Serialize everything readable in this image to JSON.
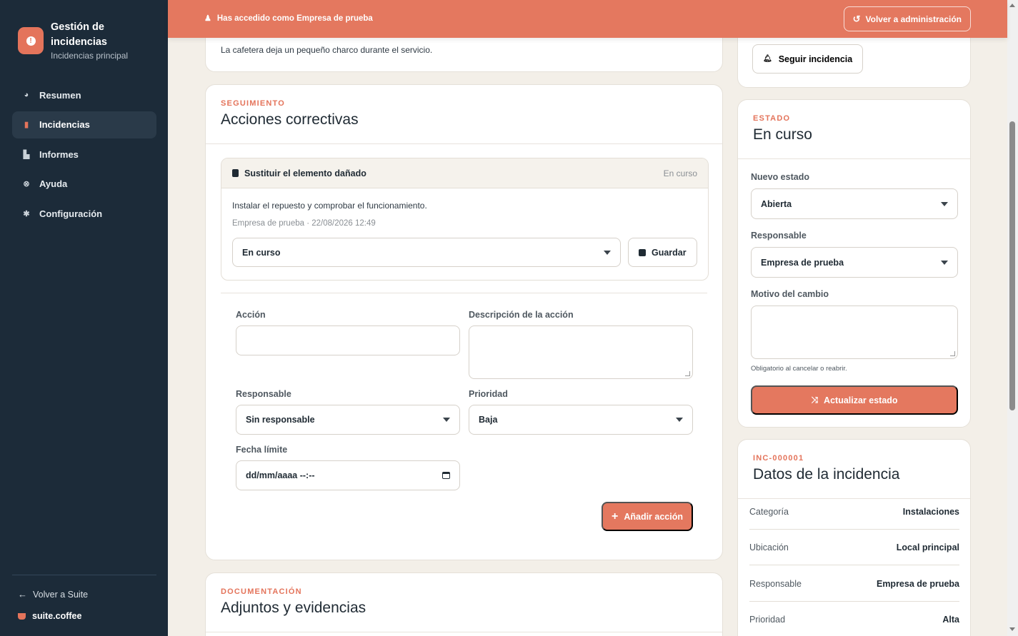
{
  "sidebar": {
    "brand_title": "Gestión de incidencias",
    "brand_subtitle": "Incidencias principal",
    "items": [
      {
        "label": "Resumen",
        "icon": "pie-chart-icon",
        "glyph": "◕"
      },
      {
        "label": "Incidencias",
        "icon": "clipboard-icon",
        "glyph": "▮"
      },
      {
        "label": "Informes",
        "icon": "bar-chart-icon",
        "glyph": "▙"
      },
      {
        "label": "Ayuda",
        "icon": "help-circle-icon",
        "glyph": "⊗"
      },
      {
        "label": "Configuración",
        "icon": "gear-icon",
        "glyph": "✱"
      }
    ],
    "active_item": "Incidencias",
    "back_label": "Volver a Suite",
    "suite_label": "suite.coffee"
  },
  "banner": {
    "text": "Has accedido como Empresa de prueba",
    "button_label": "Volver a administración"
  },
  "description": {
    "text": "La cafetera deja un pequeño charco durante el servicio."
  },
  "actions": {
    "eyebrow": "SEGUIMIENTO",
    "title": "Acciones correctivas",
    "item": {
      "name": "Sustituir el elemento dañado",
      "status": "En curso",
      "description": "Instalar el repuesto y comprobar el funcionamiento.",
      "meta": "Empresa de prueba · 22/08/2026 12:49",
      "status_select": "En curso",
      "save_label": "Guardar"
    },
    "form": {
      "action_label": "Acción",
      "action_value": "",
      "description_label": "Descripción de la acción",
      "description_value": "",
      "owner_label": "Responsable",
      "owner_value": "Sin responsable",
      "priority_label": "Prioridad",
      "priority_value": "Baja",
      "due_label": "Fecha límite",
      "due_value": "dd/mm/aaaa --:--",
      "add_label": "Añadir acción"
    }
  },
  "documents": {
    "eyebrow": "DOCUMENTACIÓN",
    "title": "Adjuntos y evidencias"
  },
  "follow": {
    "button_label": "Seguir incidencia"
  },
  "state": {
    "eyebrow": "ESTADO",
    "title": "En curso",
    "new_state_label": "Nuevo estado",
    "new_state_value": "Abierta",
    "owner_label": "Responsable",
    "owner_value": "Empresa de prueba",
    "reason_label": "Motivo del cambio",
    "reason_value": "",
    "hint": "Obligatorio al cancelar o reabrir.",
    "update_label": "Actualizar estado"
  },
  "details": {
    "eyebrow": "INC-000001",
    "title": "Datos de la incidencia",
    "rows": [
      {
        "key": "Categoría",
        "value": "Instalaciones"
      },
      {
        "key": "Ubicación",
        "value": "Local principal"
      },
      {
        "key": "Responsable",
        "value": "Empresa de prueba"
      },
      {
        "key": "Prioridad",
        "value": "Alta"
      }
    ]
  },
  "colors": {
    "accent": "#e4785f",
    "sidebar": "#1c2b39",
    "background": "#f3efe8"
  }
}
